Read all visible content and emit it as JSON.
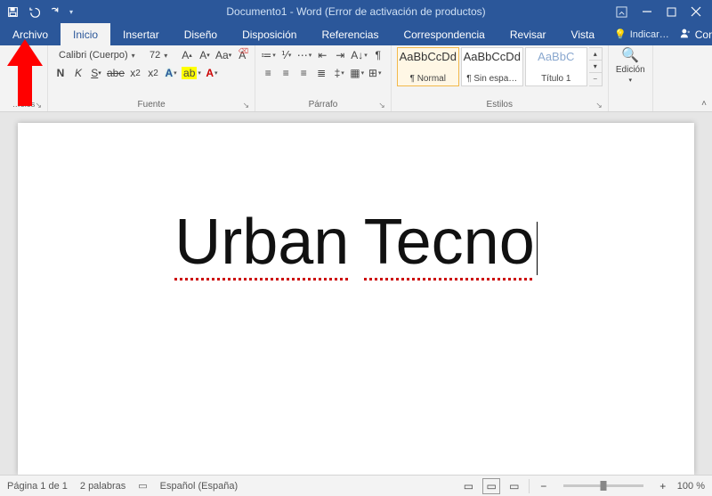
{
  "title": "Documento1 - Word (Error de activación de productos)",
  "tabs": {
    "archivo": "Archivo",
    "inicio": "Inicio",
    "insertar": "Insertar",
    "diseno": "Diseño",
    "disposicion": "Disposición",
    "referencias": "Referencias",
    "correspondencia": "Correspondencia",
    "revisar": "Revisar",
    "vista": "Vista",
    "tell": "Indicar…",
    "share": "Compartir"
  },
  "ribbon": {
    "clipboard_label": "Portapapeles",
    "font_label": "Fuente",
    "paragraph_label": "Párrafo",
    "styles_label": "Estilos",
    "editing_label": "Edición",
    "font_name": "Calibri (Cuerpo)",
    "font_size": "72",
    "styles": {
      "normal_sample": "AaBbCcDd",
      "normal_name": "¶ Normal",
      "sinespa_sample": "AaBbCcDd",
      "sinespa_name": "¶ Sin espa…",
      "titulo1_sample": "AaBbC",
      "titulo1_name": "Título 1"
    }
  },
  "document": {
    "text_word1": "Urban",
    "text_word2": "Tecno"
  },
  "status": {
    "page": "Página 1 de 1",
    "words": "2 palabras",
    "lang": "Español (España)",
    "zoom": "100 %"
  }
}
